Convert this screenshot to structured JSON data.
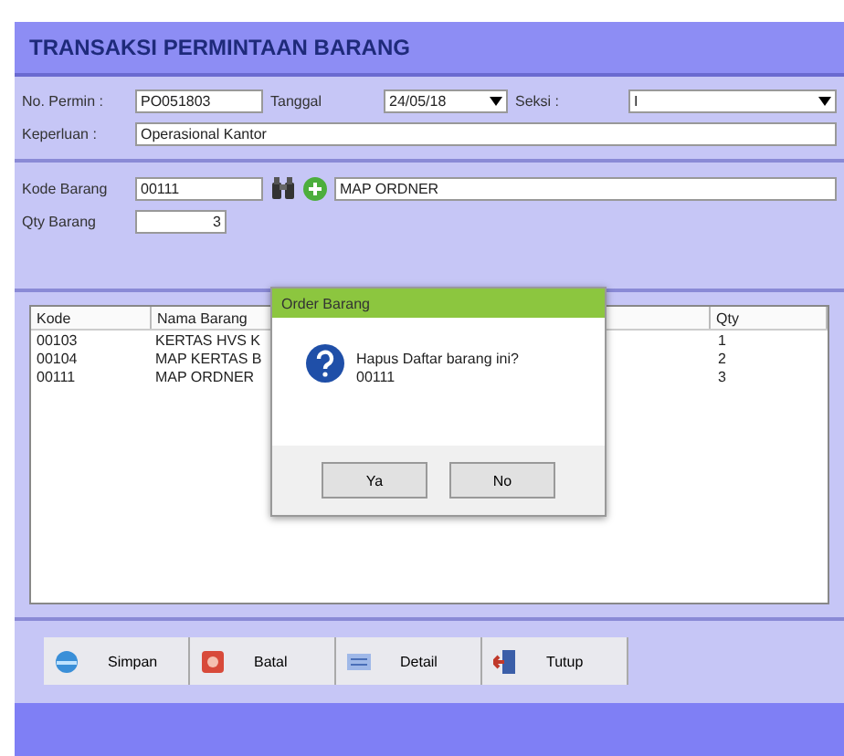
{
  "title": "TRANSAKSI PERMINTAAN BARANG",
  "header_fields": [
    {
      "label": "No. Permin :",
      "value": "PO051803",
      "kind": "text"
    },
    {
      "label": "Tanggal",
      "value": "24/05/18",
      "kind": "dropdown"
    },
    {
      "label": "Seksi :",
      "value": "I",
      "kind": "dropdown"
    }
  ],
  "keperluan": {
    "label": "Keperluan :",
    "value": "Operasional Kantor"
  },
  "kode_barang": {
    "label": "Kode Barang",
    "value": "00111",
    "name_value": "MAP ORDNER"
  },
  "qty_barang": {
    "label": "Qty Barang",
    "value": "3"
  },
  "table": {
    "columns": [
      "Kode",
      "Nama Barang",
      "Qty"
    ],
    "rows": [
      {
        "kode": "00103",
        "nama": "KERTAS HVS K",
        "qty": "1"
      },
      {
        "kode": "00104",
        "nama": "MAP KERTAS B",
        "qty": "2"
      },
      {
        "kode": "00111",
        "nama": "MAP ORDNER",
        "qty": "3"
      }
    ]
  },
  "dialog": {
    "title": "Order Barang",
    "message": "Hapus Daftar barang ini?",
    "detail": "00111",
    "buttons": [
      "Ya",
      "No"
    ]
  },
  "buttons": [
    {
      "label": "Simpan",
      "kind": "save"
    },
    {
      "label": "Batal",
      "kind": "cancel"
    },
    {
      "label": "Detail",
      "kind": "detail"
    },
    {
      "label": "Tutup",
      "kind": "close"
    }
  ]
}
